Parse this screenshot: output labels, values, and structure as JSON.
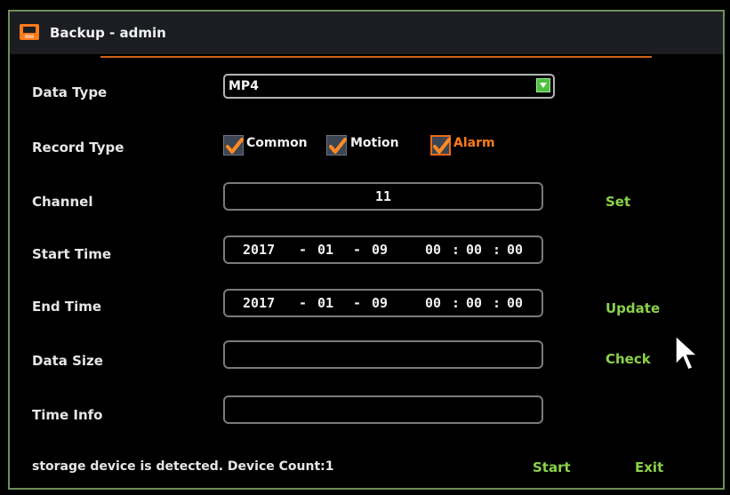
{
  "window": {
    "title": "Backup - admin",
    "icon": "save-icon",
    "accent": "#ff7a1a"
  },
  "form": {
    "data_type": {
      "label": "Data Type",
      "value": "MP4"
    },
    "record_type": {
      "label": "Record Type",
      "options": [
        {
          "label": "Common",
          "checked": true
        },
        {
          "label": "Motion",
          "checked": true
        },
        {
          "label": "Alarm",
          "checked": true
        }
      ]
    },
    "channel": {
      "label": "Channel",
      "value": "11",
      "action": "Set"
    },
    "start_time": {
      "label": "Start Time",
      "year": "2017",
      "month": "01",
      "day": "09",
      "hour": "00",
      "minute": "00",
      "second": "00",
      "date_sep": "-",
      "time_sep": ":"
    },
    "end_time": {
      "label": "End Time",
      "year": "2017",
      "month": "01",
      "day": "09",
      "hour": "00",
      "minute": "00",
      "second": "00",
      "date_sep": "-",
      "time_sep": ":",
      "action": "Update"
    },
    "data_size": {
      "label": "Data Size",
      "value": "",
      "action": "Check"
    },
    "time_info": {
      "label": "Time Info",
      "value": ""
    }
  },
  "footer": {
    "status": "storage device is detected. Device Count:1",
    "start": "Start",
    "exit": "Exit"
  },
  "colors": {
    "action_green": "#8bd24a",
    "checkbox_bg": "#3c4553",
    "border_gray": "#7a7a7a"
  }
}
